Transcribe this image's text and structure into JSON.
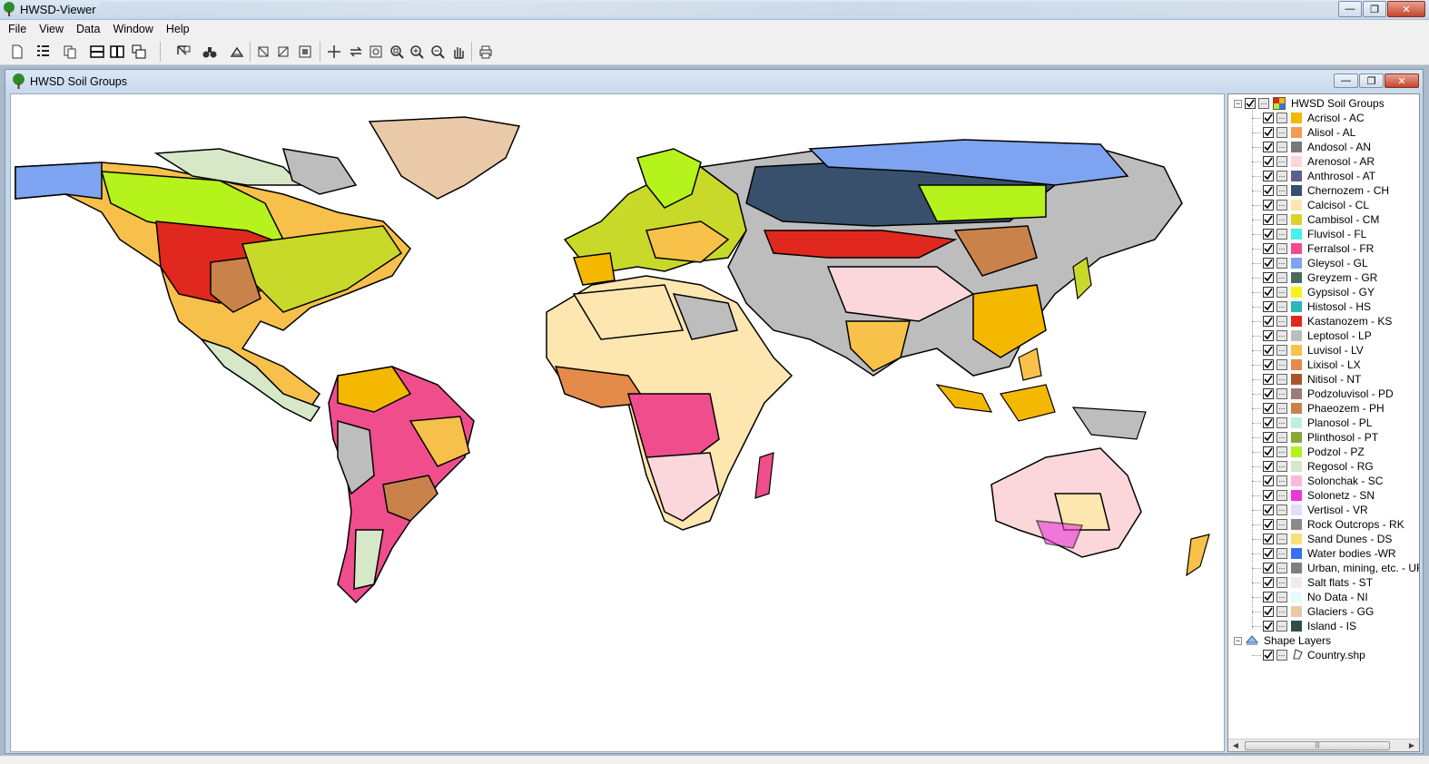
{
  "app": {
    "title": "HWSD-Viewer"
  },
  "menu": [
    "File",
    "View",
    "Data",
    "Window",
    "Help"
  ],
  "toolbar": {
    "buttons": [
      "new-file-icon",
      "layer-list-icon",
      "copy-icon",
      "tile-horizontal-icon",
      "tile-vertical-icon",
      "cascade-icon",
      "select-feature-icon",
      "identify-binoculars-icon",
      "query-icon",
      "zoom-box-icon",
      "zoom-box-alt-icon",
      "zoom-layer-icon",
      "add-point-icon",
      "pan-arrows-icon",
      "full-extent-icon",
      "zoom-extent-icon",
      "zoom-in-icon",
      "zoom-out-icon",
      "pan-hand-icon",
      "print-icon"
    ]
  },
  "child_window": {
    "title": "HWSD Soil Groups"
  },
  "legend": {
    "root": "HWSD Soil Groups",
    "items": [
      {
        "label": "Acrisol - AC",
        "color": "#f5b800"
      },
      {
        "label": "Alisol - AL",
        "color": "#f59a55"
      },
      {
        "label": "Andosol - AN",
        "color": "#787878"
      },
      {
        "label": "Arenosol - AR",
        "color": "#fbd6da"
      },
      {
        "label": "Anthrosol - AT",
        "color": "#5b5f8f"
      },
      {
        "label": "Chernozem - CH",
        "color": "#38506b"
      },
      {
        "label": "Calcisol - CL",
        "color": "#fde6b0"
      },
      {
        "label": "Cambisol - CM",
        "color": "#dcd22a"
      },
      {
        "label": "Fluvisol - FL",
        "color": "#48f0e8"
      },
      {
        "label": "Ferralsol - FR",
        "color": "#f04d8d"
      },
      {
        "label": "Gleysol - GL",
        "color": "#7ea3f0"
      },
      {
        "label": "Greyzem - GR",
        "color": "#4a6a5e"
      },
      {
        "label": "Gypsisol - GY",
        "color": "#f7f21c"
      },
      {
        "label": "Histosol - HS",
        "color": "#2ab8b8"
      },
      {
        "label": "Kastanozem - KS",
        "color": "#e0281e"
      },
      {
        "label": "Leptosol - LP",
        "color": "#bdbdbd"
      },
      {
        "label": "Luvisol - LV",
        "color": "#f8c24a"
      },
      {
        "label": "Lixisol - LX",
        "color": "#e48a4a"
      },
      {
        "label": "Nitisol - NT",
        "color": "#a6552c"
      },
      {
        "label": "Podzoluvisol - PD",
        "color": "#a07a7a"
      },
      {
        "label": "Phaeozem - PH",
        "color": "#c9824a"
      },
      {
        "label": "Planosol - PL",
        "color": "#bff0dc"
      },
      {
        "label": "Plinthosol - PT",
        "color": "#8aa83a"
      },
      {
        "label": "Podzol - PZ",
        "color": "#b6f21c"
      },
      {
        "label": "Regosol - RG",
        "color": "#d6e8c8"
      },
      {
        "label": "Solonchak - SC",
        "color": "#fbb8dc"
      },
      {
        "label": "Solonetz - SN",
        "color": "#ea38d8"
      },
      {
        "label": "Vertisol - VR",
        "color": "#e4dcfa"
      },
      {
        "label": "Rock Outcrops - RK",
        "color": "#8a8a8a"
      },
      {
        "label": "Sand Dunes - DS",
        "color": "#fbe07a"
      },
      {
        "label": "Water bodies -WR",
        "color": "#3a6ff0"
      },
      {
        "label": "Urban, mining, etc. - UR",
        "color": "#7f7f7f"
      },
      {
        "label": "Salt flats - ST",
        "color": "#f2eaee"
      },
      {
        "label": "No Data - NI",
        "color": "#e6fbf8"
      },
      {
        "label": "Glaciers - GG",
        "color": "#e9c9a8"
      },
      {
        "label": "Island - IS",
        "color": "#2f4f4f"
      }
    ],
    "shape_group": "Shape Layers",
    "shape_items": [
      {
        "label": "Country.shp",
        "icon": "polygon-layer-icon"
      }
    ]
  }
}
